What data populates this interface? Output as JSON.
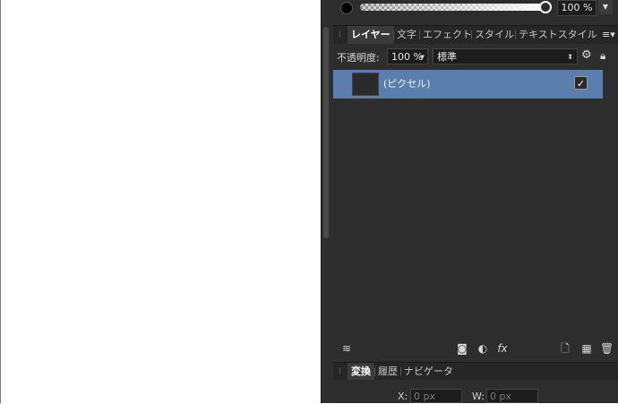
{
  "color": {
    "opacity_value": "100 %"
  },
  "tabs": [
    "レイヤー",
    "文字",
    "エフェクト",
    "スタイル",
    "テキストスタイル"
  ],
  "layers_panel": {
    "opacity_label": "不透明度:",
    "opacity_value": "100 %",
    "blend_mode": "標準",
    "layers": [
      {
        "name": "(ピクセル)",
        "visible": true,
        "selected": true
      }
    ]
  },
  "bottom_tabs": [
    "変換",
    "履歴",
    "ナビゲータ"
  ],
  "transform": {
    "x_label": "X:",
    "x_value": "0 px",
    "w_label": "W:",
    "w_value": "0 px"
  },
  "colors": {
    "selection": "#5a7fad",
    "panel_bg": "#2d2d2d",
    "canvas_bg": "#ffffff"
  },
  "icons": [
    "color-swatch-icon",
    "grip-icon",
    "panel-menu-icon",
    "gear-icon",
    "lock-icon",
    "layers-stack-icon",
    "mask-icon",
    "adjustment-icon",
    "fx-icon",
    "new-layer-icon",
    "pixel-layer-icon",
    "trash-icon"
  ]
}
